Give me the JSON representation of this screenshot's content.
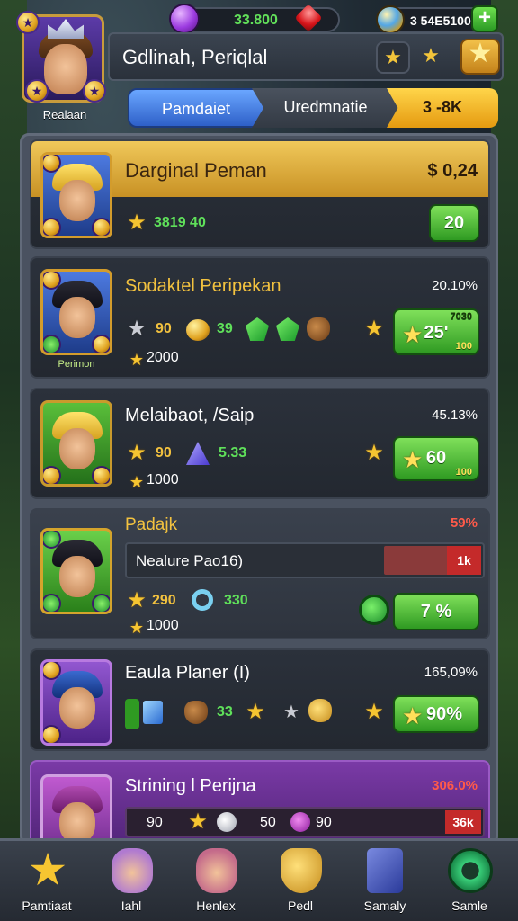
{
  "header": {
    "gems_value": "33.800",
    "coins_value": "3 54E5100",
    "plus_label": "+",
    "player_name": "Gdlinah, Periqlal",
    "avatar_caption": "Realaan",
    "avatar_badge_left": "★",
    "avatar_badge_right": "★"
  },
  "tabs": [
    {
      "label": "Pamdaiet"
    },
    {
      "label": "Uredmnatie"
    },
    {
      "label": "3 -8K"
    }
  ],
  "rows": [
    {
      "title": "Darginal Peman",
      "percent": "$ 0,24",
      "stat1": "3819 40",
      "button": "20"
    },
    {
      "title": "Sodaktel Peripekan",
      "percent": "20.10%",
      "portrait_caption": "Perimon",
      "stat_a": "90",
      "stat_b": "39",
      "stat_c": "2000",
      "button": "25'",
      "button_top": "7030",
      "button_sub": "100"
    },
    {
      "title": "Melaibaot, /Saip",
      "percent": "45.13%",
      "stat_a": "90",
      "stat_b": "5.33",
      "stat_c": "1000",
      "button": "60",
      "button_sub": "100"
    },
    {
      "title": "Padajk",
      "percent": "59%",
      "progress_label": "Nealure Pao16)",
      "progress_tag": "1k",
      "stat_a": "290",
      "stat_b": "330",
      "stat_c": "1000",
      "button": "7 %"
    },
    {
      "title": "Eaula Planer (I)",
      "percent": "165,09%",
      "stat_b": "33",
      "button": "90%"
    },
    {
      "title": "Strining l Perijna",
      "percent": "306.0%",
      "stat_a": "90",
      "stat_b": "50",
      "stat_c": "90",
      "tag": "36k"
    }
  ],
  "bottom_nav": [
    {
      "label": "Pamtiaat",
      "icon": "star-icon"
    },
    {
      "label": "Iahl",
      "icon": "cat-icon"
    },
    {
      "label": "Henlex",
      "icon": "hero-icon"
    },
    {
      "label": "Pedl",
      "icon": "shield-icon"
    },
    {
      "label": "Samaly",
      "icon": "box-icon"
    },
    {
      "label": "Samle",
      "icon": "settings-icon"
    }
  ],
  "colors": {
    "accent_gold": "#f3c23f",
    "accent_green": "#5fe05a",
    "tab_blue": "#2e60c8",
    "panel": "#4a5260"
  }
}
